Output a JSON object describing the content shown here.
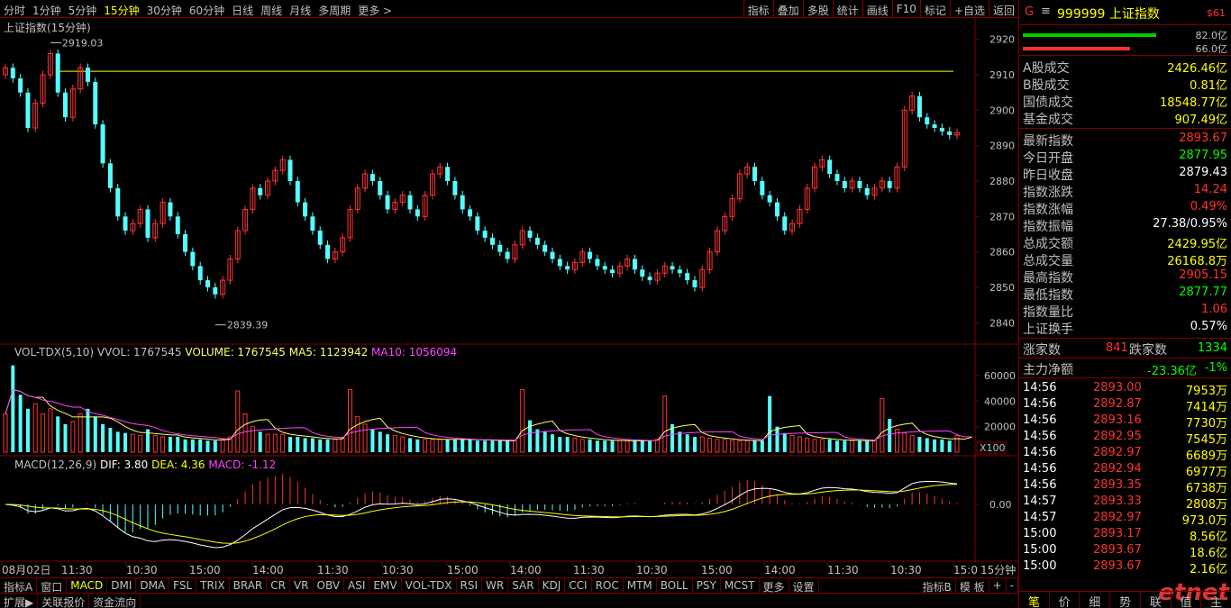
{
  "toolbar": {
    "periods": [
      "分时",
      "1分钟",
      "5分钟",
      "15分钟",
      "30分钟",
      "60分钟",
      "日线",
      "周线",
      "月线",
      "多周期",
      "更多 >"
    ],
    "active_period": "15分钟",
    "tools": [
      "指标",
      "叠加",
      "多股",
      "统计",
      "画线",
      "F10",
      "标记",
      "+自选",
      "返回"
    ]
  },
  "main_panel": {
    "title": "上证指数(15分钟)",
    "high_label": "2919.03",
    "low_label": "2839.39"
  },
  "vol_panel": {
    "title": "VOL-TDX(5,10)",
    "vvol": "VVOL: 1767545",
    "volume": "VOLUME: 1767545",
    "ma5": "MA5: 1123942",
    "ma10": "MA10: 1056094",
    "unit": "X100"
  },
  "macd_panel": {
    "title": "MACD(12,26,9)",
    "dif": "DIF: 3.80",
    "dea": "DEA: 4.36",
    "macd": "MACD: -1.12"
  },
  "chart_data": {
    "type": "candlestick",
    "title": "上证指数(15分钟)",
    "y_range": [
      2836,
      2924
    ],
    "y_ticks": [
      2840,
      2850,
      2860,
      2870,
      2880,
      2890,
      2900,
      2910,
      2920
    ],
    "reference_line": 2911,
    "high": 2919.03,
    "low": 2839.39,
    "x_labels": [
      "08月02日",
      "11:30",
      "10:30",
      "15:00",
      "14:00",
      "11:30",
      "10:30",
      "15:00",
      "14:00",
      "11:30",
      "10:30",
      "15:00",
      "14:00",
      "11:30",
      "10:30",
      "15:0"
    ],
    "volume_ticks": [
      "60000",
      "40000",
      "20000"
    ],
    "volume_range": [
      0,
      72000
    ],
    "macd_ticks": [
      "0.00"
    ],
    "closes": [
      2912,
      2909,
      2905,
      2895,
      2902,
      2910,
      2916,
      2905,
      2898,
      2906,
      2912,
      2908,
      2896,
      2885,
      2878,
      2870,
      2866,
      2868,
      2872,
      2864,
      2868,
      2874,
      2870,
      2865,
      2860,
      2856,
      2852,
      2850,
      2848,
      2852,
      2858,
      2866,
      2872,
      2878,
      2876,
      2880,
      2883,
      2886,
      2880,
      2874,
      2870,
      2866,
      2862,
      2858,
      2860,
      2864,
      2872,
      2878,
      2882,
      2880,
      2876,
      2872,
      2874,
      2876,
      2872,
      2870,
      2876,
      2882,
      2884,
      2880,
      2876,
      2872,
      2870,
      2866,
      2864,
      2862,
      2860,
      2858,
      2862,
      2866,
      2864,
      2862,
      2860,
      2858,
      2856,
      2855,
      2857,
      2860,
      2858,
      2856,
      2855,
      2854,
      2856,
      2858,
      2855,
      2853,
      2852,
      2854,
      2856,
      2855,
      2854,
      2852,
      2850,
      2855,
      2860,
      2866,
      2870,
      2875,
      2882,
      2884,
      2880,
      2876,
      2874,
      2870,
      2866,
      2868,
      2872,
      2878,
      2884,
      2886,
      2882,
      2880,
      2878,
      2880,
      2878,
      2876,
      2878,
      2880,
      2878,
      2884,
      2900,
      2904,
      2898,
      2896,
      2895,
      2894,
      2893,
      2893.67
    ],
    "volumes": [
      30000,
      68000,
      45000,
      34000,
      38000,
      30000,
      34000,
      28000,
      22000,
      24000,
      30000,
      34000,
      28000,
      22000,
      19000,
      16000,
      15000,
      14000,
      13000,
      18000,
      13000,
      12000,
      12000,
      12000,
      10000,
      10000,
      10000,
      9000,
      9000,
      10000,
      12000,
      48000,
      30000,
      20000,
      16000,
      14000,
      14000,
      14000,
      12000,
      12000,
      11000,
      11000,
      10000,
      10000,
      10000,
      11000,
      49000,
      28000,
      22000,
      18000,
      16000,
      14000,
      13000,
      12000,
      11000,
      10000,
      10000,
      10000,
      10000,
      10000,
      10000,
      10000,
      10000,
      9000,
      9000,
      9000,
      9000,
      9000,
      9000,
      49000,
      25000,
      18000,
      16000,
      14000,
      12000,
      12000,
      11000,
      10000,
      10000,
      9000,
      9000,
      9000,
      9000,
      9000,
      9000,
      9000,
      9000,
      10000,
      44000,
      22000,
      16000,
      14000,
      12000,
      12000,
      11000,
      10000,
      10000,
      9000,
      9000,
      9000,
      9000,
      9000,
      44000,
      20000,
      15000,
      13000,
      12000,
      11000,
      10000,
      10000,
      10000,
      9000,
      9000,
      9000,
      9000,
      9000,
      9000,
      42000,
      26000,
      18000,
      15000,
      13000,
      12000,
      11000,
      10000,
      10000,
      9000,
      13000,
      9000,
      17675
    ]
  },
  "side": {
    "g": "G",
    "menu": "≡",
    "code": "999999 上证指数",
    "num": "$61",
    "bar_values": [
      "82.0亿",
      "66.0亿"
    ],
    "bar_green_ratio": 0.82,
    "bar_red_ratio": 0.66,
    "turnover": [
      {
        "k": "A股成交",
        "v": "2426.46亿"
      },
      {
        "k": "B股成交",
        "v": "0.81亿"
      },
      {
        "k": "国债成交",
        "v": "18548.77亿"
      },
      {
        "k": "基金成交",
        "v": "907.49亿"
      }
    ],
    "quotes": [
      {
        "k": "最新指数",
        "v": "2893.67",
        "c": "rise"
      },
      {
        "k": "今日开盘",
        "v": "2877.95",
        "c": "fall"
      },
      {
        "k": "昨日收盘",
        "v": "2879.43",
        "c": "flat"
      },
      {
        "k": "指数涨跌",
        "v": "14.24",
        "c": "rise"
      },
      {
        "k": "指数涨幅",
        "v": "0.49%",
        "c": "rise"
      },
      {
        "k": "指数振幅",
        "v": "27.38/0.95%",
        "c": "flat"
      },
      {
        "k": "总成交额",
        "v": "2429.95亿",
        "c": "yel"
      },
      {
        "k": "总成交量",
        "v": "26168.8万",
        "c": "yel"
      },
      {
        "k": "最高指数",
        "v": "2905.15",
        "c": "rise"
      },
      {
        "k": "最低指数",
        "v": "2877.77",
        "c": "fall"
      },
      {
        "k": "指数量比",
        "v": "1.06",
        "c": "rise"
      },
      {
        "k": "上证换手",
        "v": "0.57%",
        "c": "flat"
      }
    ],
    "breadth": {
      "up_label": "涨家数",
      "up": "841",
      "down_label": "跌家数",
      "down": "1334"
    },
    "mainflow": {
      "k": "主力净额",
      "v": "-23.36亿",
      "pct": "-1%"
    },
    "trades": [
      {
        "t": "14:56",
        "p": "2893.00",
        "v": "7953万"
      },
      {
        "t": "14:56",
        "p": "2892.87",
        "v": "7414万"
      },
      {
        "t": "14:56",
        "p": "2893.16",
        "v": "7730万"
      },
      {
        "t": "14:56",
        "p": "2892.95",
        "v": "7545万"
      },
      {
        "t": "14:56",
        "p": "2892.97",
        "v": "6689万"
      },
      {
        "t": "14:56",
        "p": "2892.94",
        "v": "6977万"
      },
      {
        "t": "14:56",
        "p": "2893.35",
        "v": "6738万"
      },
      {
        "t": "14:57",
        "p": "2893.33",
        "v": "2808万"
      },
      {
        "t": "14:57",
        "p": "2892.97",
        "v": "973.0万"
      },
      {
        "t": "15:00",
        "p": "2893.17",
        "v": "8.56亿"
      },
      {
        "t": "15:00",
        "p": "2893.67",
        "v": "18.6亿"
      },
      {
        "t": "15:00",
        "p": "2893.67",
        "v": "2.16亿"
      }
    ],
    "tabs": [
      "笔",
      "价",
      "细",
      "势",
      "联",
      "值",
      "主"
    ],
    "active_tab": "笔",
    "watermark": "etnet"
  },
  "indicators": {
    "left": [
      "指标A",
      "窗口",
      "MACD",
      "DMI",
      "DMA",
      "FSL",
      "TRIX",
      "BRAR",
      "CR",
      "VR",
      "OBV",
      "ASI",
      "EMV",
      "VOL-TDX",
      "RSI",
      "WR",
      "SAR",
      "KDJ",
      "CCI",
      "ROC",
      "MTM",
      "BOLL",
      "PSY",
      "MCST",
      "更多",
      "设置"
    ],
    "active": "MACD",
    "right": [
      "指标B",
      "模 板",
      "+",
      "-"
    ],
    "ext": [
      "扩展▶",
      "关联报价",
      "资金流向"
    ],
    "period_label": "15分钟"
  },
  "colors": {
    "rise": "#ff3333",
    "fall": "#54ffff",
    "grid": "#800000",
    "axis_text": "#c0c0c0",
    "ma5": "#ffff66",
    "ma10": "#ff44ff",
    "dif": "#ffffff",
    "dea": "#ffff00",
    "ref_line": "#ffff00"
  }
}
